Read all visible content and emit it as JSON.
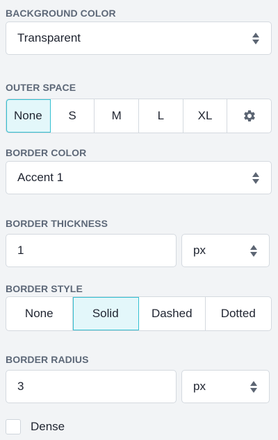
{
  "background_color": {
    "label": "BACKGROUND COLOR",
    "value": "Transparent"
  },
  "outer_space": {
    "label": "OUTER SPACE",
    "options": [
      "None",
      "S",
      "M",
      "L",
      "XL"
    ],
    "selected": "None",
    "settings_icon": "gear-icon"
  },
  "border_color": {
    "label": "BORDER COLOR",
    "value": "Accent 1"
  },
  "border_thickness": {
    "label": "BORDER THICKNESS",
    "value": "1",
    "unit": "px"
  },
  "border_style": {
    "label": "BORDER STYLE",
    "options": [
      "None",
      "Solid",
      "Dashed",
      "Dotted"
    ],
    "selected": "Solid"
  },
  "border_radius": {
    "label": "BORDER RADIUS",
    "value": "3",
    "unit": "px"
  },
  "dense": {
    "label": "Dense",
    "checked": false
  },
  "colors": {
    "accent": "#33bfd1",
    "active_bg": "#e3f7fa",
    "label": "#5d6878"
  }
}
